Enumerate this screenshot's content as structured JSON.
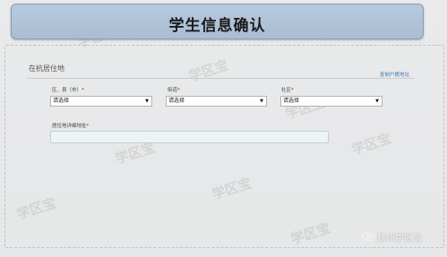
{
  "header": {
    "title": "学生信息确认"
  },
  "section": {
    "title": "在杭居住地",
    "copy_link": "复制户籍地址"
  },
  "fields": {
    "district": {
      "label": "区、县（市）",
      "required_mark": "*",
      "value": "请选择"
    },
    "street": {
      "label": "街道",
      "required_mark": "*",
      "value": "请选择"
    },
    "community": {
      "label": "社区",
      "required_mark": "*",
      "value": "请选择"
    },
    "address": {
      "label": "居住地详细地址",
      "required_mark": "*",
      "value": ""
    }
  },
  "watermarks": {
    "text": "学区宝"
  },
  "brand": {
    "name": "杭州学区宝",
    "icon": "wechat-icon"
  },
  "colors": {
    "header_bg": "#b0c3d8",
    "link": "#4a7fb5",
    "required": "#d0021b",
    "input_border": "#b9d3df"
  }
}
